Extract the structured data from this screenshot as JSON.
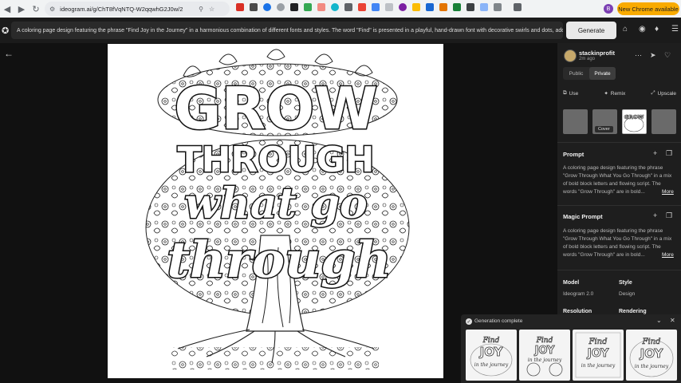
{
  "browser": {
    "url": "ideogram.ai/g/ChT8fVqNTQ-W2qqwhG2J0w/2",
    "update_button": "New Chrome available",
    "profile_initial": "B"
  },
  "header": {
    "prompt": "A coloring page design featuring the phrase \"Find Joy in the Journey\" in a harmonious combination of different fonts and styles. The word \"Find\" is presented in a playful, hand-drawn font with decorative swirls and dots, adding",
    "generate_label": "Generate"
  },
  "artwork": {
    "line1": "GROW",
    "line2": "THROUGH",
    "line3": "what go",
    "line4": "through"
  },
  "panel": {
    "username": "stackinprofit",
    "time_ago": "2m ago",
    "visibility": {
      "public": "Public",
      "private": "Private"
    },
    "actions": {
      "use": "Use",
      "remix": "Remix",
      "upscale": "Upscale"
    },
    "thumb_text": "GROW",
    "cover_tooltip": "Cover",
    "prompt_title": "Prompt",
    "prompt_text": "A coloring page design featuring the phrase \"Grow Through What You Go Through\" in a mix of bold block letters and flowing script. The words \"Grow Through\" are in bold...",
    "more": "More",
    "magic_title": "Magic Prompt",
    "magic_text": "A coloring page design featuring the phrase \"Grow Through What You Go Through\" in a mix of bold block letters and flowing script. The words \"Grow Through\" are in bold...",
    "model_label": "Model",
    "model_value": "Ideogram 2.0",
    "style_label": "Style",
    "style_value": "Design",
    "resolution_label": "Resolution",
    "rendering_label": "Rendering"
  },
  "generation": {
    "status": "Generation complete",
    "thumbs": [
      {
        "line1": "Find",
        "line2": "JOY",
        "line3": "in the journey"
      },
      {
        "line1": "Find",
        "line2": "JOY",
        "line3": "in the journey"
      },
      {
        "line1": "Find",
        "line2": "JOY",
        "line3": "in the journey"
      },
      {
        "line1": "Find",
        "line2": "JOY",
        "line3": "in the journey"
      }
    ]
  },
  "colors": {
    "accent": "#f9ab00",
    "panel": "#1e1e1e",
    "background": "#111111"
  }
}
